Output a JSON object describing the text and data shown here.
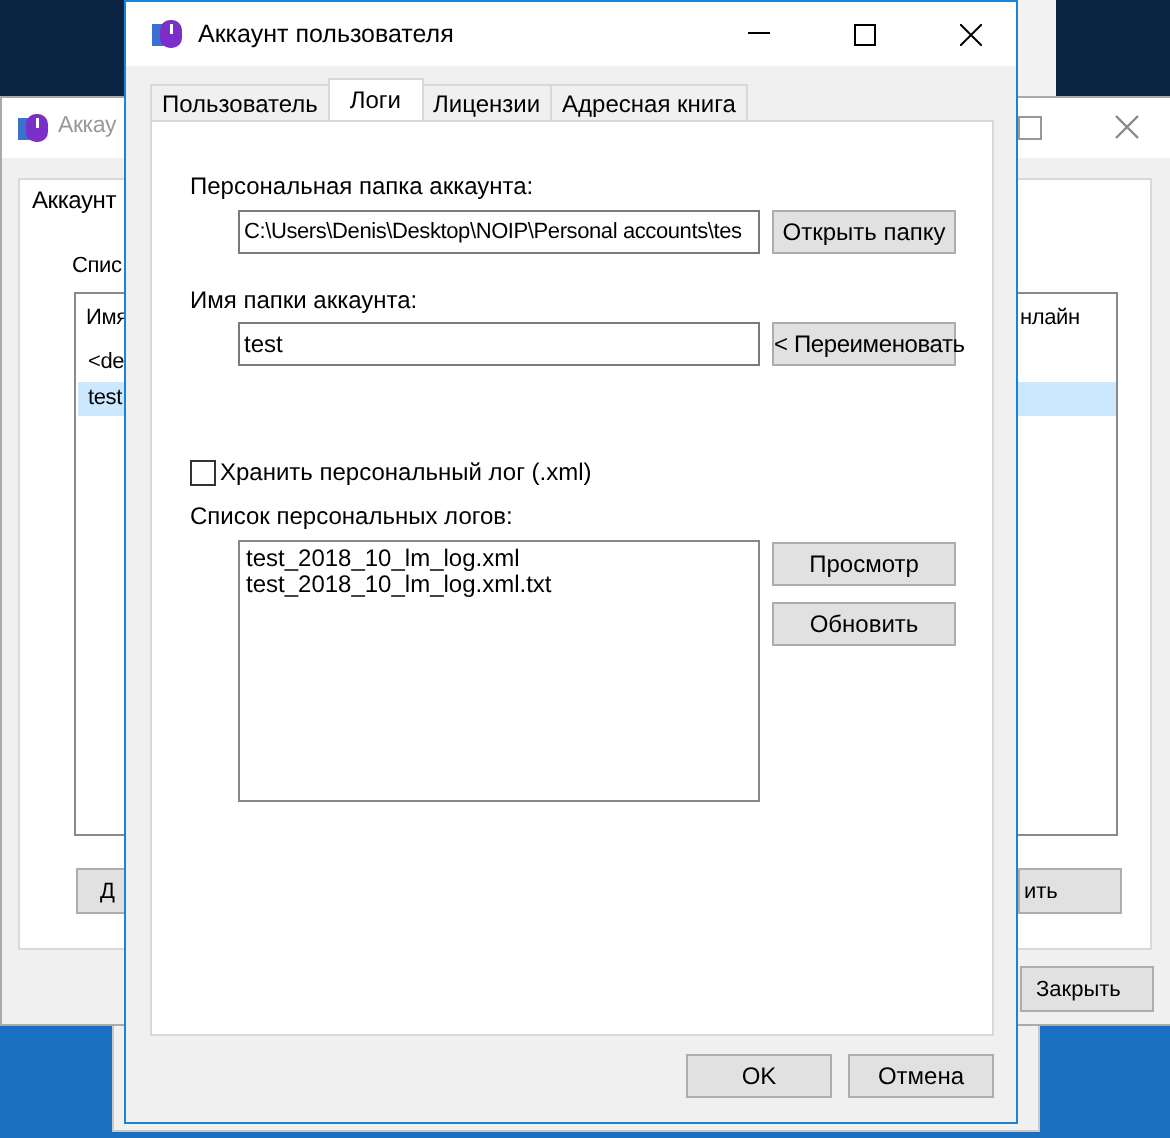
{
  "back_window": {
    "title": "Аккау",
    "tab": "Аккаунт",
    "list_label": "Спис",
    "columns": [
      "Имя",
      "нлайн"
    ],
    "rows": [
      {
        "name": "<de",
        "selected": false
      },
      {
        "name": "test",
        "selected": true
      }
    ],
    "buttons": [
      "Д",
      "ить",
      "Закрыть"
    ]
  },
  "window": {
    "title": "Аккаунт пользователя"
  },
  "tabs": [
    {
      "label": "Пользователь",
      "selected": false
    },
    {
      "label": "Логи",
      "selected": true
    },
    {
      "label": "Лицензии",
      "selected": false
    },
    {
      "label": "Адресная книга",
      "selected": false
    }
  ],
  "folder": {
    "label": "Персональная папка аккаунта:",
    "value": "C:\\Users\\Denis\\Desktop\\NOIP\\Personal accounts\\tes",
    "button": "Открыть папку"
  },
  "folder_name": {
    "label": "Имя папки аккаунта:",
    "value": "test",
    "button": "< Переименовать"
  },
  "keep_log": {
    "label": "Хранить персональный лог (.xml)",
    "checked": false
  },
  "logs": {
    "label": "Список персональных логов:",
    "items": [
      "test_2018_10_lm_log.xml",
      "test_2018_10_lm_log.xml.txt"
    ],
    "buttons": [
      "Просмотр",
      "Обновить"
    ]
  },
  "buttons": [
    "OK",
    "Отмена"
  ]
}
